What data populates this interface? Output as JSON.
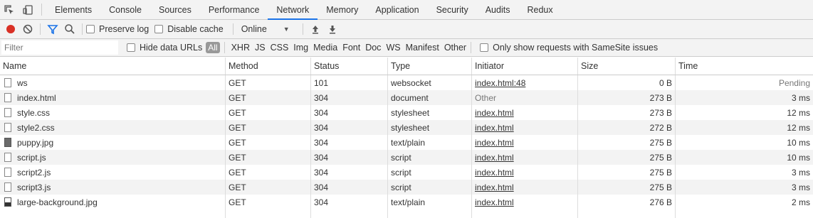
{
  "tabs": [
    "Elements",
    "Console",
    "Sources",
    "Performance",
    "Network",
    "Memory",
    "Application",
    "Security",
    "Audits",
    "Redux"
  ],
  "active_tab": "Network",
  "toolbar": {
    "preserve_log": "Preserve log",
    "disable_cache": "Disable cache",
    "throttle": "Online"
  },
  "filter": {
    "placeholder": "Filter",
    "hide_data_urls": "Hide data URLs",
    "all": "All",
    "types": [
      "XHR",
      "JS",
      "CSS",
      "Img",
      "Media",
      "Font",
      "Doc",
      "WS",
      "Manifest",
      "Other"
    ],
    "samesite": "Only show requests with SameSite issues"
  },
  "columns": {
    "name": "Name",
    "method": "Method",
    "status": "Status",
    "type": "Type",
    "initiator": "Initiator",
    "size": "Size",
    "time": "Time"
  },
  "requests": [
    {
      "name": "ws",
      "method": "GET",
      "status": "101",
      "type": "websocket",
      "initiator": "index.html:48",
      "size": "0 B",
      "time": "Pending",
      "icon": "doc"
    },
    {
      "name": "index.html",
      "method": "GET",
      "status": "304",
      "type": "document",
      "initiator": "Other",
      "size": "273 B",
      "time": "3 ms",
      "icon": "doc"
    },
    {
      "name": "style.css",
      "method": "GET",
      "status": "304",
      "type": "stylesheet",
      "initiator": "index.html",
      "size": "273 B",
      "time": "12 ms",
      "icon": "doc"
    },
    {
      "name": "style2.css",
      "method": "GET",
      "status": "304",
      "type": "stylesheet",
      "initiator": "index.html",
      "size": "272 B",
      "time": "12 ms",
      "icon": "doc"
    },
    {
      "name": "puppy.jpg",
      "method": "GET",
      "status": "304",
      "type": "text/plain",
      "initiator": "index.html",
      "size": "275 B",
      "time": "10 ms",
      "icon": "img"
    },
    {
      "name": "script.js",
      "method": "GET",
      "status": "304",
      "type": "script",
      "initiator": "index.html",
      "size": "275 B",
      "time": "10 ms",
      "icon": "doc"
    },
    {
      "name": "script2.js",
      "method": "GET",
      "status": "304",
      "type": "script",
      "initiator": "index.html",
      "size": "275 B",
      "time": "3 ms",
      "icon": "doc"
    },
    {
      "name": "script3.js",
      "method": "GET",
      "status": "304",
      "type": "script",
      "initiator": "index.html",
      "size": "275 B",
      "time": "3 ms",
      "icon": "doc"
    },
    {
      "name": "large-background.jpg",
      "method": "GET",
      "status": "304",
      "type": "text/plain",
      "initiator": "index.html",
      "size": "276 B",
      "time": "2 ms",
      "icon": "img2"
    }
  ],
  "colors": {
    "record": "#d93025",
    "filter_icon": "#1a73e8",
    "active_tab_underline": "#1a73e8"
  }
}
